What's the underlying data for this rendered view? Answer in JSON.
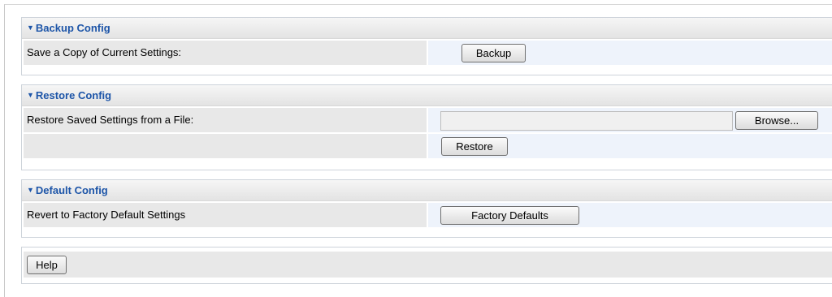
{
  "backup": {
    "title": "Backup Config",
    "row_label": "Save a Copy of Current Settings:",
    "button_label": "Backup"
  },
  "restore": {
    "title": "Restore Config",
    "row_label": "Restore Saved Settings from a File:",
    "file_value": "",
    "browse_label": "Browse...",
    "restore_label": "Restore"
  },
  "default": {
    "title": "Default Config",
    "row_label": "Revert to Factory Default Settings",
    "button_label": "Factory Defaults"
  },
  "footer": {
    "help_label": "Help"
  },
  "colors": {
    "section_title": "#1d55a8",
    "label_bg": "#e8e8e8",
    "value_bg": "#eef3fb"
  },
  "icons": {
    "section_toggle": "triangle-down-icon"
  }
}
